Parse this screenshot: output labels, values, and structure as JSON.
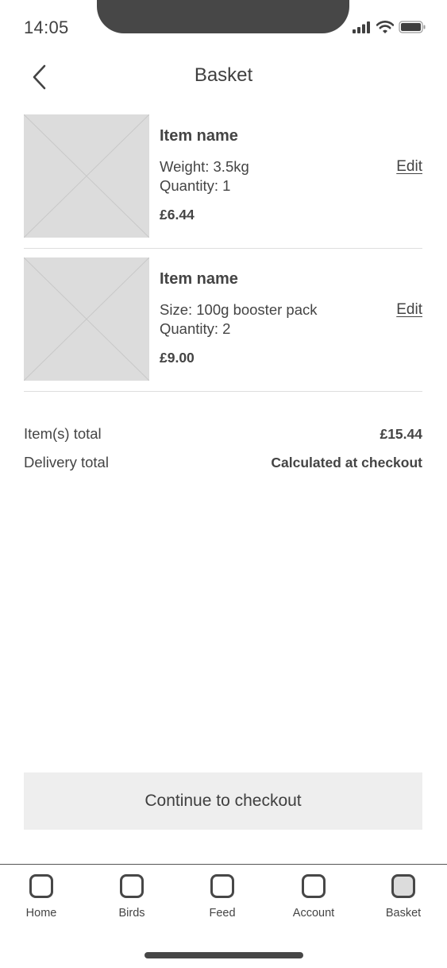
{
  "status_bar": {
    "time": "14:05",
    "icons": [
      "signal-icon",
      "wifi-icon",
      "battery-icon"
    ]
  },
  "header": {
    "back_icon": "chevron-left-icon",
    "title": "Basket"
  },
  "items": [
    {
      "name": "Item name",
      "detail_1": "Weight: 3.5kg",
      "detail_2": "Quantity: 1",
      "price": "£6.44",
      "edit_label": "Edit",
      "image": "placeholder-image"
    },
    {
      "name": "Item name",
      "detail_1": "Size: 100g booster pack",
      "detail_2": "Quantity: 2",
      "price": "£9.00",
      "edit_label": "Edit",
      "image": "placeholder-image"
    }
  ],
  "summary": {
    "items_total_label": "Item(s) total",
    "items_total_value": "£15.44",
    "delivery_label": "Delivery total",
    "delivery_value": "Calculated at checkout"
  },
  "cta": {
    "label": "Continue to checkout"
  },
  "tab_bar": {
    "active": "Basket",
    "tabs": [
      {
        "label": "Home"
      },
      {
        "label": "Birds"
      },
      {
        "label": "Feed"
      },
      {
        "label": "Account"
      },
      {
        "label": "Basket"
      }
    ]
  },
  "colors": {
    "text": "#444444",
    "notch": "#474747",
    "placeholder": "#dcdcdc",
    "button_bg": "#eeeeee"
  }
}
